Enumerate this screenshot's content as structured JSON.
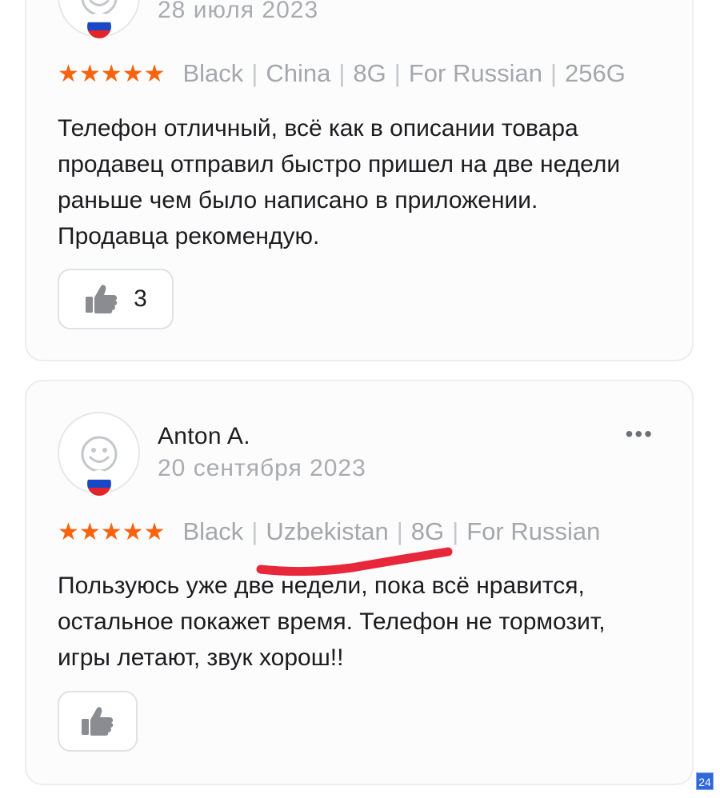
{
  "reviews": [
    {
      "date": "28 июля 2023",
      "stars": "★★★★★",
      "options": [
        "Black",
        "China",
        "8G",
        "For Russian",
        "256G"
      ],
      "text": "Телефон отличный, всё как в описании товара продавец отправил быстро пришел на две недели раньше чем было написано в приложении. Продавца рекомендую.",
      "likes": "3",
      "flag": "russia-flag-icon"
    },
    {
      "author": "Anton A.",
      "date": "20 сентября 2023",
      "stars": "★★★★★",
      "options": [
        "Black",
        "Uzbekistan",
        "8G",
        "For Russian"
      ],
      "text": "Пользуюсь уже две недели, пока всё нравится, остальное покажет время. Телефон не тормозит, игры летают, звук хорош!!",
      "more": "•••",
      "flag": "russia-flag-icon"
    }
  ],
  "badge": "24",
  "colors": {
    "star": "#f8630e",
    "muted": "#a5a7ac",
    "annotation": "#e8273a",
    "card_bg": "#fcfcfd",
    "border": "#ecedf0"
  }
}
